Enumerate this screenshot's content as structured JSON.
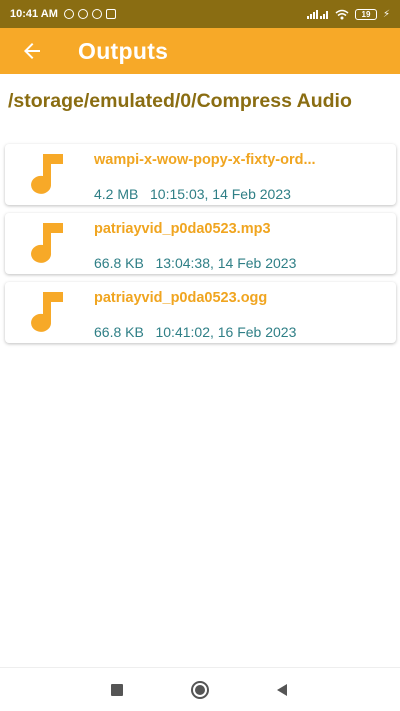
{
  "status_bar": {
    "time": "10:41 AM",
    "battery": "19"
  },
  "app_bar": {
    "title": "Outputs",
    "back_icon": "arrow-left-icon"
  },
  "path": "/storage/emulated/0/Compress Audio",
  "files": [
    {
      "name": "wampi-x-wow-popy-x-fixty-ord...",
      "meta": "4.2 MB   10:15:03, 14 Feb 2023",
      "icon": "music-note-icon"
    },
    {
      "name": "patriayvid_p0da0523.mp3",
      "meta": "66.8 KB   13:04:38, 14 Feb 2023",
      "icon": "music-note-icon"
    },
    {
      "name": "patriayvid_p0da0523.ogg",
      "meta": "66.8 KB   10:41:02, 16 Feb 2023",
      "icon": "music-note-icon"
    }
  ],
  "colors": {
    "status_bar": "#8a6d12",
    "app_bar": "#f7a928",
    "path_text": "#8a6d12",
    "file_name": "#f0a520",
    "file_meta": "#2f7f86"
  }
}
